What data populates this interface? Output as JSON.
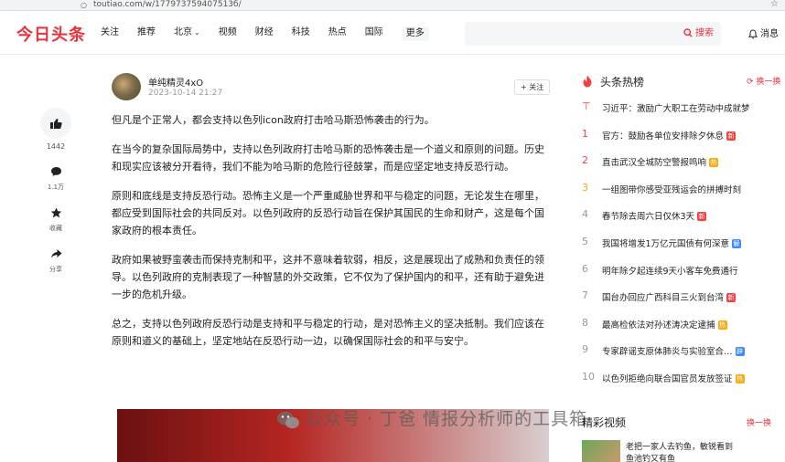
{
  "browser": {
    "url": "toutiao.com/w/177973759407513б/"
  },
  "header": {
    "logo": "今日头条",
    "nav": [
      "关注",
      "推荐",
      "北京",
      "视频",
      "财经",
      "科技",
      "热点",
      "国际"
    ],
    "more": "更多",
    "search_placeholder": "",
    "search_button": "搜索",
    "messages": "消息"
  },
  "sidebar": {
    "likes": "1442",
    "comments": "1.1万",
    "collect": "收藏",
    "share": "分享"
  },
  "author": {
    "name": "单纯精灵4xO",
    "date": "2023-10-14 21:27",
    "follow": "+ 关注"
  },
  "article": {
    "paragraphs": [
      "但凡是个正常人，都会支持以色列icon政府打击哈马斯恐怖袭击的行为。",
      "在当今的复杂国际局势中，支持以色列政府打击哈马斯的恐怖袭击是一个道义和原则的问题。历史和现实应该被分开看待，我们不能为哈马斯的危险行径鼓掌，而是应坚定地支持反恐行动。",
      "原则和底线是支持反恐行动。恐怖主义是一个严重威胁世界和平与稳定的问题，无论发生在哪里，都应受到国际社会的共同反对。以色列政府的反恐行动旨在保护其国民的生命和财产，这是每个国家政府的根本责任。",
      "政府如果被野蛮袭击而保持克制和平，这并不意味着软弱，相反，这是展现出了成熟和负责任的领导。以色列政府的克制表现了一种智慧的外交政策，它不仅为了保护国内的和平，还有助于避免进一步的危机升级。",
      "总之，支持以色列政府反恐行动是支持和平与稳定的行动，是对恐怖主义的坚决抵制。我们应该在原则和道义的基础上，坚定地站在反恐行动一边，以确保国际社会的和平与安宁。"
    ]
  },
  "watermark": "公众号 · 丁爸 情报分析师的工具箱",
  "hot": {
    "title": "头条热榜",
    "refresh": "换一换",
    "items": [
      {
        "rank": "",
        "text": "习近平：激励广大职工在劳动中成就梦"
      },
      {
        "rank": "1",
        "text": "官方：鼓励各单位安排除夕休息",
        "badge": "新"
      },
      {
        "rank": "2",
        "text": "直击武汉全城防空警报鸣响",
        "badge": "热"
      },
      {
        "rank": "3",
        "text": "一组图带你感受亚残运会的拼搏时刻"
      },
      {
        "rank": "4",
        "text": "春节除去周六日仅休3天",
        "badge": "新"
      },
      {
        "rank": "5",
        "text": "我国将增发1万亿元国债有何深意",
        "badge": "解"
      },
      {
        "rank": "6",
        "text": "明年除夕起连续9天小客车免费通行"
      },
      {
        "rank": "7",
        "text": "国台办回应广西科目三火到台湾",
        "badge": "新"
      },
      {
        "rank": "8",
        "text": "最高检依法对孙述涛决定逮捕",
        "badge": "热"
      },
      {
        "rank": "9",
        "text": "专家辟谣支原体肺炎与实验室合…",
        "badge": "辟"
      },
      {
        "rank": "10",
        "text": "以色列拒绝向联合国官员发放签证",
        "badge": "热"
      }
    ]
  },
  "recommend": {
    "title": "精彩视频",
    "refresh": "换一换",
    "line1": "老把一家人去钓鱼，敏锐看到",
    "line2": "鱼池钓又有鱼"
  },
  "colors": {
    "brand": "#e8323c",
    "hot_rank": "#f04142",
    "third_rank": "#faa90e"
  }
}
